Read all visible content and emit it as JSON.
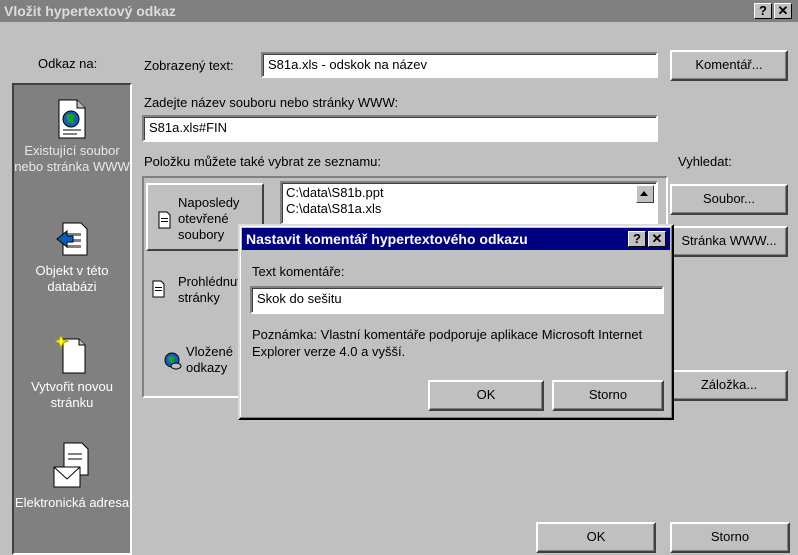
{
  "window": {
    "title": "Vložit hypertextový odkaz",
    "help_btn": "?",
    "close_btn": "✕"
  },
  "link_to": {
    "label": "Odkaz na:",
    "items": [
      {
        "label": "Existující soubor nebo stránka WWW",
        "icon": "web-page-icon",
        "selected": true
      },
      {
        "label": "Objekt v této databázi",
        "icon": "database-object-icon"
      },
      {
        "label": "Vytvořit novou stránku",
        "icon": "new-page-icon"
      },
      {
        "label": "Elektronická adresa",
        "icon": "email-icon"
      }
    ]
  },
  "display_text": {
    "label": "Zobrazený text:",
    "value": "S81a.xls - odskok na název"
  },
  "comment_button": "Komentář...",
  "filename": {
    "label": "Zadejte název souboru nebo stránky WWW:",
    "value": "S81a.xls#FIN"
  },
  "list_label": "Položku můžete také vybrat ze seznamu:",
  "search_label": "Vyhledat:",
  "list_buttons": {
    "recent": "Naposledy otevřené soubory",
    "browsed": "Prohlédnuté stránky",
    "inserted": "Vložené odkazy"
  },
  "file_list": [
    "C:\\data\\S81b.ppt",
    "C:\\data\\S81a.xls"
  ],
  "search_buttons": {
    "file": "Soubor...",
    "web_page": "Stránka WWW...",
    "bookmark": "Záložka..."
  },
  "footer": {
    "ok": "OK",
    "cancel": "Storno"
  },
  "comment_dialog": {
    "title": "Nastavit komentář hypertextového odkazu",
    "help_btn": "?",
    "close_btn": "✕",
    "text_label": "Text komentáře:",
    "text_value": "Skok do sešitu",
    "note": "Poznámka: Vlastní komentáře podporuje aplikace Microsoft Internet Explorer verze 4.0 a vyšší.",
    "ok": "OK",
    "cancel": "Storno"
  }
}
